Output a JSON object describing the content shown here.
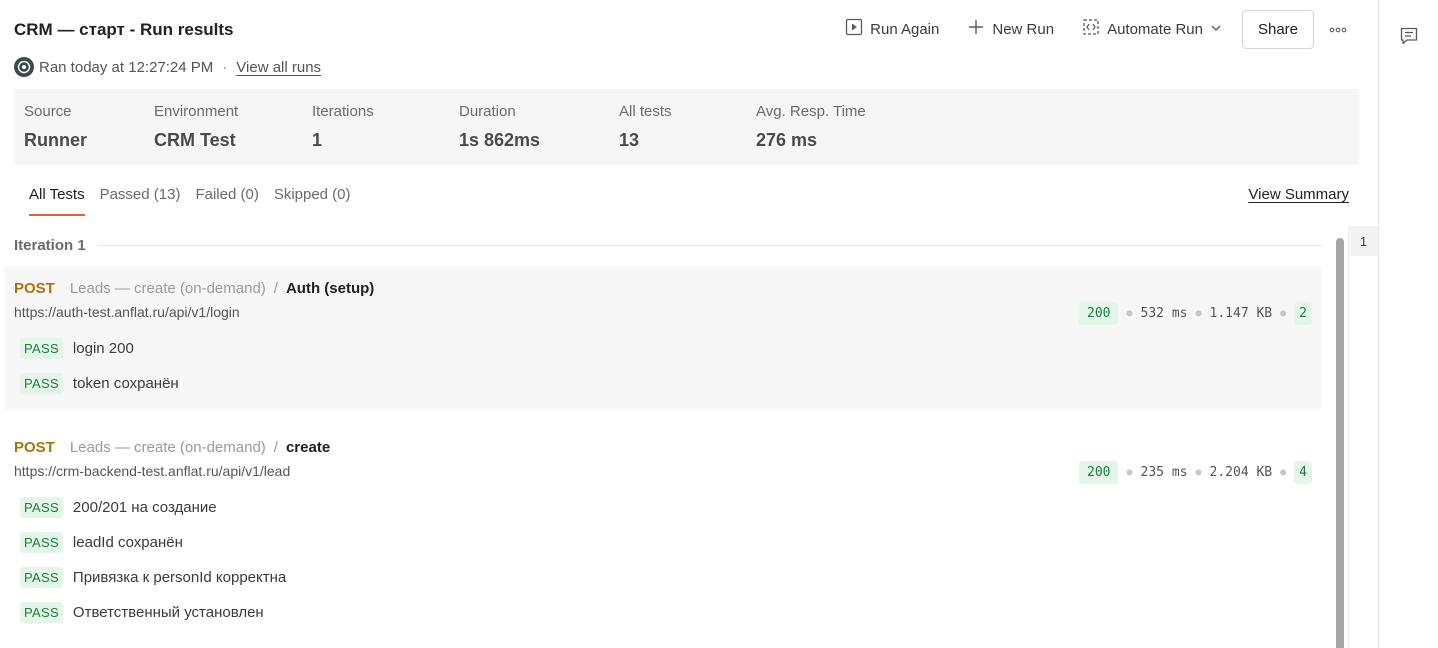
{
  "header": {
    "title": "CRM — старт - Run results",
    "run_again": "Run Again",
    "new_run": "New Run",
    "automate_run": "Automate Run",
    "share": "Share"
  },
  "subline": {
    "ran_at": "Ran today at 12:27:24 PM",
    "separator": "·",
    "view_all_runs": "View all runs"
  },
  "stats": [
    {
      "label": "Source",
      "value": "Runner"
    },
    {
      "label": "Environment",
      "value": "CRM Test"
    },
    {
      "label": "Iterations",
      "value": "1"
    },
    {
      "label": "Duration",
      "value": "1s 862ms"
    },
    {
      "label": "All tests",
      "value": "13"
    },
    {
      "label": "Avg. Resp. Time",
      "value": "276 ms"
    }
  ],
  "tabs": [
    {
      "label": "All Tests",
      "active": true
    },
    {
      "label": "Passed (13)"
    },
    {
      "label": "Failed (0)"
    },
    {
      "label": "Skipped (0)"
    }
  ],
  "view_summary": "View Summary",
  "iteration": {
    "label": "Iteration 1",
    "nav_number": "1"
  },
  "requests": [
    {
      "method": "POST",
      "collection": "Leads — create (on-demand)",
      "separator": "/",
      "name": "Auth (setup)",
      "url": "https://auth-test.anflat.ru/api/v1/login",
      "status": "200",
      "time": "532 ms",
      "size": "1.147 KB",
      "test_count": "2",
      "tests": [
        {
          "badge": "PASS",
          "name": "login 200"
        },
        {
          "badge": "PASS",
          "name": "token сохранён"
        }
      ]
    },
    {
      "method": "POST",
      "collection": "Leads — create (on-demand)",
      "separator": "/",
      "name": "create",
      "url": "https://crm-backend-test.anflat.ru/api/v1/lead",
      "status": "200",
      "time": "235 ms",
      "size": "2.204 KB",
      "test_count": "4",
      "tests": [
        {
          "badge": "PASS",
          "name": "200/201 на создание"
        },
        {
          "badge": "PASS",
          "name": "leadId сохранён"
        },
        {
          "badge": "PASS",
          "name": "Привязка к personId корректна"
        },
        {
          "badge": "PASS",
          "name": "Ответственный установлен"
        }
      ]
    }
  ],
  "colors": {
    "accent": "#e0643a",
    "method_post": "#a8730b",
    "pass_bg": "#e4f6e9",
    "pass_text": "#1b7f3b"
  },
  "icons": [
    "play-icon",
    "plus-icon",
    "automate-icon",
    "chevron-down-icon",
    "more-icon",
    "comment-icon",
    "runner-avatar-icon"
  ]
}
